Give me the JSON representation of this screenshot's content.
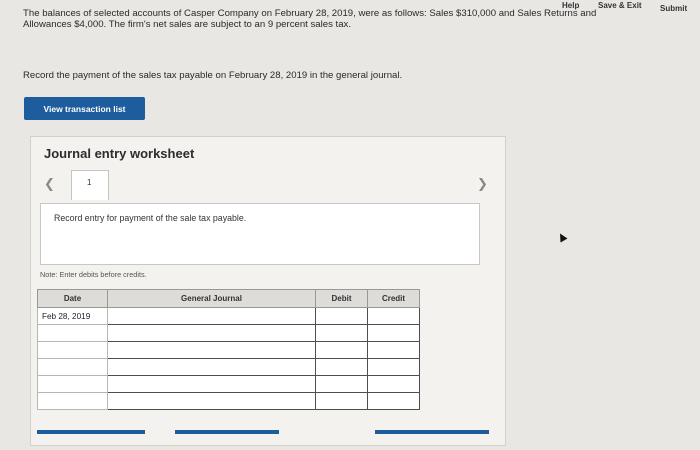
{
  "topbar": {
    "help_label": "Help",
    "save_exit_label": "Save & Exit",
    "submit_label": "Submit"
  },
  "intro": {
    "line1": "The balances of selected accounts of Casper Company on February 28, 2019, were as follows: Sales $310,000 and Sales Returns and",
    "line2": "Allowances $4,000. The firm's net sales are subject to an 9 percent sales tax."
  },
  "instruction": "Record the payment of the sales tax payable on February 28, 2019 in the general journal.",
  "view_transaction_list_label": "View transaction list",
  "worksheet": {
    "title": "Journal entry worksheet",
    "prev_icon": "chevron-left-icon",
    "next_icon": "chevron-right-icon",
    "current_page": "1",
    "entry_prompt": "Record entry for payment of the sale tax payable.",
    "note": "Note: Enter debits before credits.",
    "columns": [
      "Date",
      "General Journal",
      "Debit",
      "Credit"
    ],
    "rows": [
      {
        "date": "Feb 28, 2019",
        "account": "",
        "debit": "",
        "credit": ""
      },
      {
        "date": "",
        "account": "",
        "debit": "",
        "credit": ""
      },
      {
        "date": "",
        "account": "",
        "debit": "",
        "credit": ""
      },
      {
        "date": "",
        "account": "",
        "debit": "",
        "credit": ""
      },
      {
        "date": "",
        "account": "",
        "debit": "",
        "credit": ""
      },
      {
        "date": "",
        "account": "",
        "debit": "",
        "credit": ""
      }
    ]
  },
  "colors": {
    "accent_blue": "#1d5d9e",
    "background": "#e9e7e3"
  }
}
